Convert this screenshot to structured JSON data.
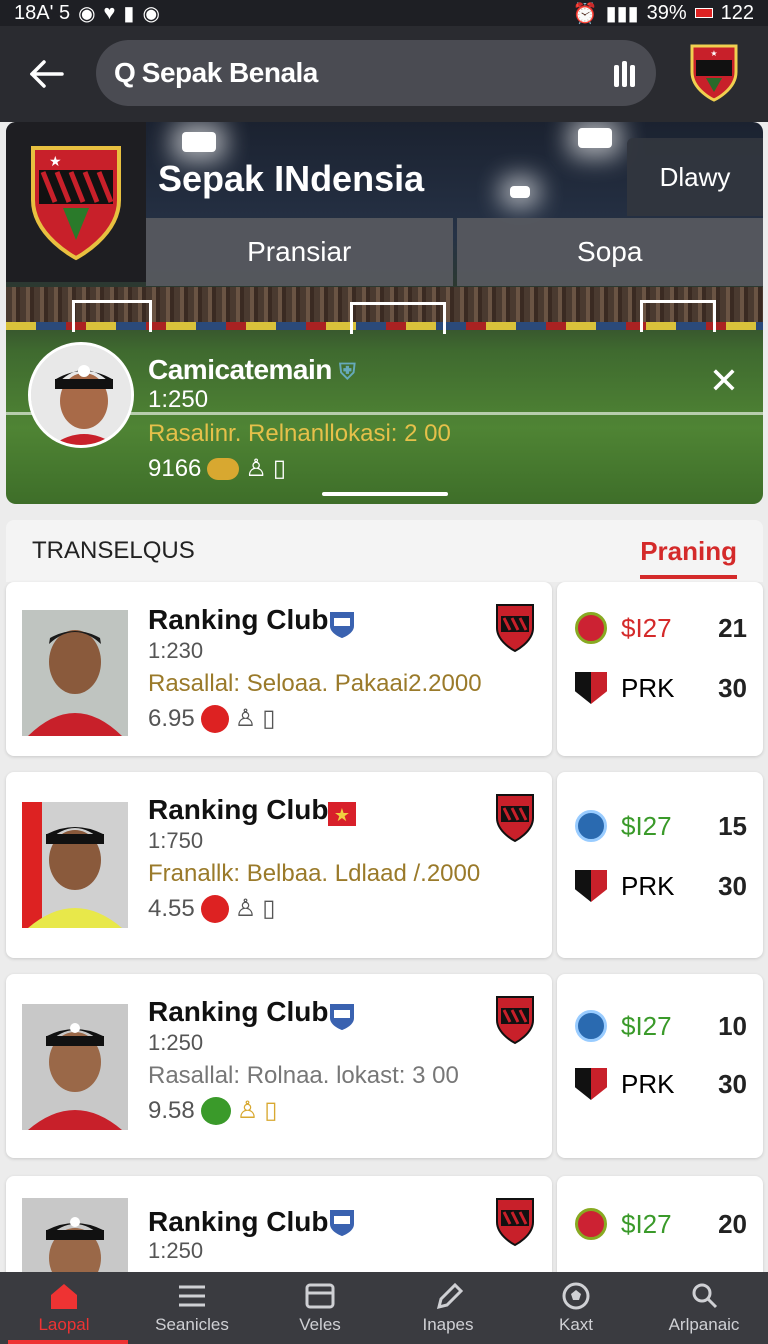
{
  "status": {
    "left": "18A' 5",
    "battery": "39%",
    "time": "122"
  },
  "search": {
    "value": "Sepak Benala"
  },
  "hero": {
    "title": "Sepak INdensia",
    "right_button": "Dlawy",
    "tabs": [
      "Pransiar",
      "Sopa"
    ],
    "player": {
      "name": "Camicatemain",
      "time": "1:250",
      "info": "Rasalinr. Relnanllokasi: 2 00",
      "stat": "9166"
    }
  },
  "section": {
    "title": "TRANSELQUS",
    "link": "Praning"
  },
  "cards": [
    {
      "title": "Ranking Club",
      "time": "1:230",
      "info": "Rasallal: Seloaa. Pakaai2.2000",
      "stat": "6.95",
      "side": [
        {
          "label": "$I27",
          "num": "21",
          "color": "#d42a2a"
        },
        {
          "label": "PRK",
          "num": "30",
          "color": "#222"
        }
      ]
    },
    {
      "title": "Ranking Club",
      "time": "1:750",
      "info": "Franallk: Belbaa. Ldlaad /.2000",
      "stat": "4.55",
      "side": [
        {
          "label": "$I27",
          "num": "15",
          "color": "#3a9a2a"
        },
        {
          "label": "PRK",
          "num": "30",
          "color": "#222"
        }
      ]
    },
    {
      "title": "Ranking Club",
      "time": "1:250",
      "info": "Rasallal: Rolnaa. lokast: 3 00",
      "stat": "9.58",
      "side": [
        {
          "label": "$I27",
          "num": "10",
          "color": "#3a9a2a"
        },
        {
          "label": "PRK",
          "num": "30",
          "color": "#222"
        }
      ]
    },
    {
      "title": "Ranking Club",
      "time": "1:250",
      "info": "",
      "stat": "",
      "side": [
        {
          "label": "$I27",
          "num": "20",
          "color": "#3a9a2a"
        }
      ]
    }
  ],
  "nav": [
    "Laopal",
    "Seanicles",
    "Veles",
    "Inapes",
    "Kaxt",
    "Arlpanaic"
  ],
  "colors": {
    "accent": "#d42a2a",
    "green": "#3a9a2a",
    "gold": "#9a7a2a"
  }
}
